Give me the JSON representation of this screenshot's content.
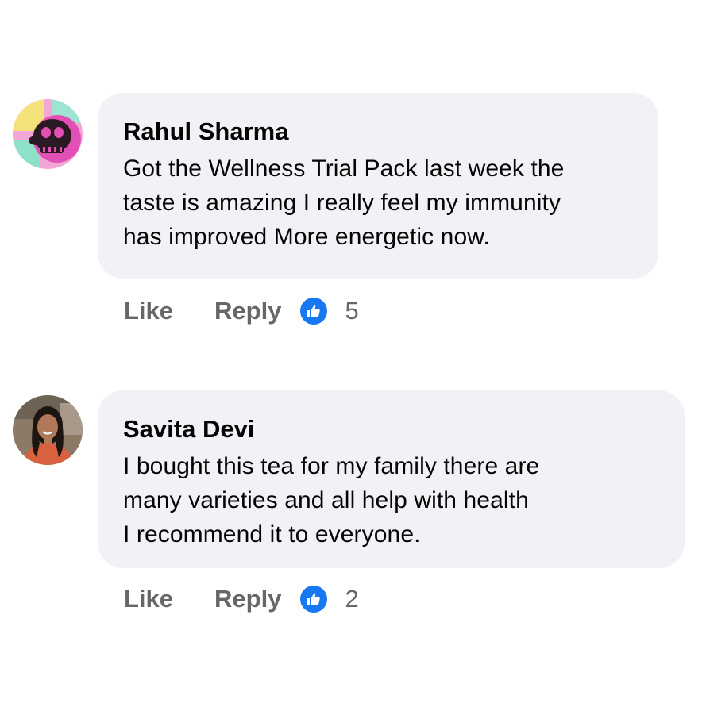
{
  "comments": [
    {
      "author": "Rahul Sharma",
      "lines": [
        "Got the Wellness Trial Pack last week the",
        "taste is amazing I really feel my immunity",
        "has improved More energetic now."
      ],
      "actions": {
        "like_label": "Like",
        "reply_label": "Reply"
      },
      "reaction_icon": "thumbs-up-icon",
      "like_count": "5"
    },
    {
      "author": "Savita Devi",
      "lines": [
        "I bought this tea for my family there are",
        "many varieties and all help with health",
        "I recommend it to everyone."
      ],
      "actions": {
        "like_label": "Like",
        "reply_label": "Reply"
      },
      "reaction_icon": "thumbs-up-icon",
      "like_count": "2"
    }
  ],
  "colors": {
    "bubble": "#f0f2f5",
    "author_text": "#050505",
    "action_text": "#65676b",
    "reaction_badge": "#1877f2"
  }
}
